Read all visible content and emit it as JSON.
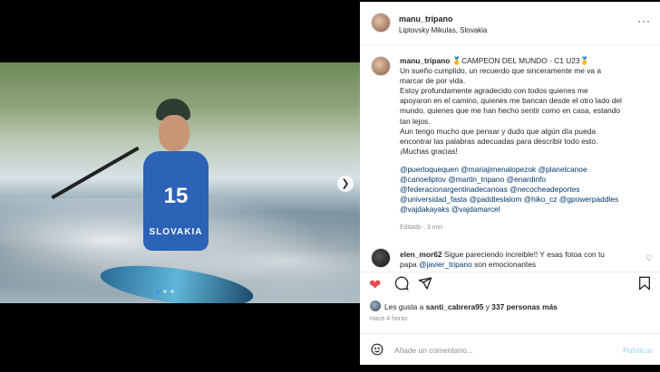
{
  "post": {
    "username": "manu_tripano",
    "location": "Liptovsky Mikulas, Slovakia",
    "more_label": "···",
    "caption_title": "🥇CAMPEON DEL MUNDO - C1 U23🥇",
    "caption_lines": [
      "Un sueño cumplido, un recuerdo que sinceramente me va a",
      "marcar de por vida.",
      "Estoy profundamente agradecido con todos quienes me",
      "apoyaron en el camino, quienes me bancan desde el otro lado del",
      "mundo, quienes que me han hecho sentir como en casa, estando",
      "tan lejos.",
      "Aun tengo mucho que pensar y dudo que algún día pueda",
      "encontrar las palabras adecuadas para describir todo esto.",
      "¡Muchas gracias!"
    ],
    "tag_lines": [
      "@puertoquequen @mariajimenalopezok @planetcanoe",
      "@canoeliptov @martin_tripano @enardinfo",
      "@federacionargentinadecanoas @necocheadeportes",
      "@universidad_fasta @paddleslalom @hiko_cz @gpowerpaddles",
      "@vajdakayaks @vajdamarcel"
    ],
    "edited": "Editado · 3 min",
    "photo": {
      "bib_number": "15",
      "bib_text": "SLOVAKIA"
    }
  },
  "comment": {
    "username": "elen_mor62",
    "text": " Sigue pareciendo increible!! Y esas fotoa con tu",
    "text2_prefix": "papa ",
    "mention": "@javier_tripano",
    "text2_suffix": " son emocionantes"
  },
  "likes": {
    "prefix": "Les gusta a ",
    "user": "santi_cabrera95",
    "middle": " y ",
    "count": "337 personas más"
  },
  "time": "Hace 4 horas",
  "composer": {
    "placeholder": "Añade un comentario...",
    "publish": "Publicar"
  },
  "icons": {
    "like": "heart-icon",
    "comment": "comment-icon",
    "share": "share-icon",
    "save": "bookmark-icon",
    "emoji": "emoji-icon",
    "next": "chevron-right-icon"
  },
  "colors": {
    "like_red": "#ed4956",
    "link_blue": "#00376b",
    "publish_disabled": "#b2dffc"
  }
}
